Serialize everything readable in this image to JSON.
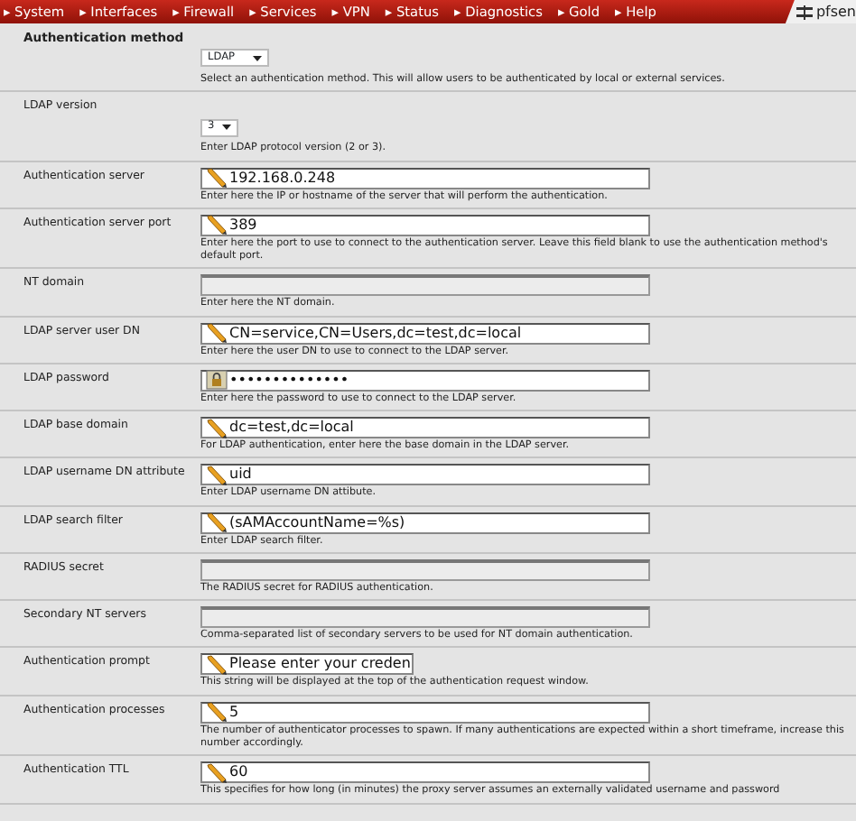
{
  "nav": {
    "items": [
      {
        "label": "System",
        "marker": "▸"
      },
      {
        "label": "Interfaces",
        "marker": "▸"
      },
      {
        "label": "Firewall",
        "marker": "▸"
      },
      {
        "label": "Services",
        "marker": "▸"
      },
      {
        "label": "VPN",
        "marker": "▸"
      },
      {
        "label": "Status",
        "marker": "▸"
      },
      {
        "label": "Diagnostics",
        "marker": "▸"
      },
      {
        "label": "Gold",
        "marker": "▸"
      },
      {
        "label": "Help",
        "marker": "▸"
      }
    ],
    "logo": "pfsen"
  },
  "form": {
    "rows": [
      {
        "label": "Authentication method",
        "bold": true,
        "kind": "select",
        "value": "LDAP",
        "help": "Select an authentication method. This will allow users to be authenticated by local or external services."
      },
      {
        "label": "LDAP version",
        "bold": false,
        "kind": "select-small",
        "value": "3",
        "help": "Enter LDAP protocol version (2 or 3)."
      },
      {
        "label": "Authentication server",
        "bold": false,
        "kind": "text",
        "value": "192.168.0.248",
        "help": "Enter here the IP or hostname of the server that will perform the authentication."
      },
      {
        "label": "Authentication server port",
        "bold": false,
        "kind": "text",
        "value": "389",
        "help": "Enter here the port to use to connect to the authentication server. Leave this field blank to use the authentication method's default port."
      },
      {
        "label": "NT domain",
        "bold": false,
        "kind": "disabled",
        "help": "Enter here the NT domain."
      },
      {
        "label": "LDAP server user DN",
        "bold": false,
        "kind": "text",
        "value": "CN=service,CN=Users,dc=test,dc=local",
        "help": "Enter here the user DN to use to connect to the LDAP server."
      },
      {
        "label": "LDAP password",
        "bold": false,
        "kind": "password",
        "value": "••••••••••••••",
        "help": "Enter here the password to use to connect to the LDAP server."
      },
      {
        "label": "LDAP base domain",
        "bold": false,
        "kind": "text",
        "value": "dc=test,dc=local",
        "help": "For LDAP authentication, enter here the base domain in the LDAP server."
      },
      {
        "label": "LDAP username DN attribute",
        "bold": false,
        "kind": "text",
        "value": "uid",
        "help": "Enter LDAP username DN attibute."
      },
      {
        "label": "LDAP search filter",
        "bold": false,
        "kind": "text",
        "value": "(sAMAccountName=%s)",
        "help": "Enter LDAP search filter."
      },
      {
        "label": "RADIUS secret",
        "bold": false,
        "kind": "disabled",
        "help": "The RADIUS secret for RADIUS authentication."
      },
      {
        "label": "Secondary NT servers",
        "bold": false,
        "kind": "disabled",
        "help": "Comma-separated list of secondary servers to be used for NT domain authentication."
      },
      {
        "label": "Authentication prompt",
        "bold": false,
        "kind": "text-short",
        "value": "Please enter your creden",
        "help": "This string will be displayed at the top of the authentication request window."
      },
      {
        "label": "Authentication processes",
        "bold": false,
        "kind": "text",
        "value": "5",
        "help": "The number of authenticator processes to spawn. If many authentications are expected within a short timeframe, increase this number accordingly."
      },
      {
        "label": "Authentication TTL",
        "bold": false,
        "kind": "text",
        "value": "60",
        "help": "This specifies for how long (in minutes) the proxy server assumes an externally validated username and password"
      }
    ]
  }
}
